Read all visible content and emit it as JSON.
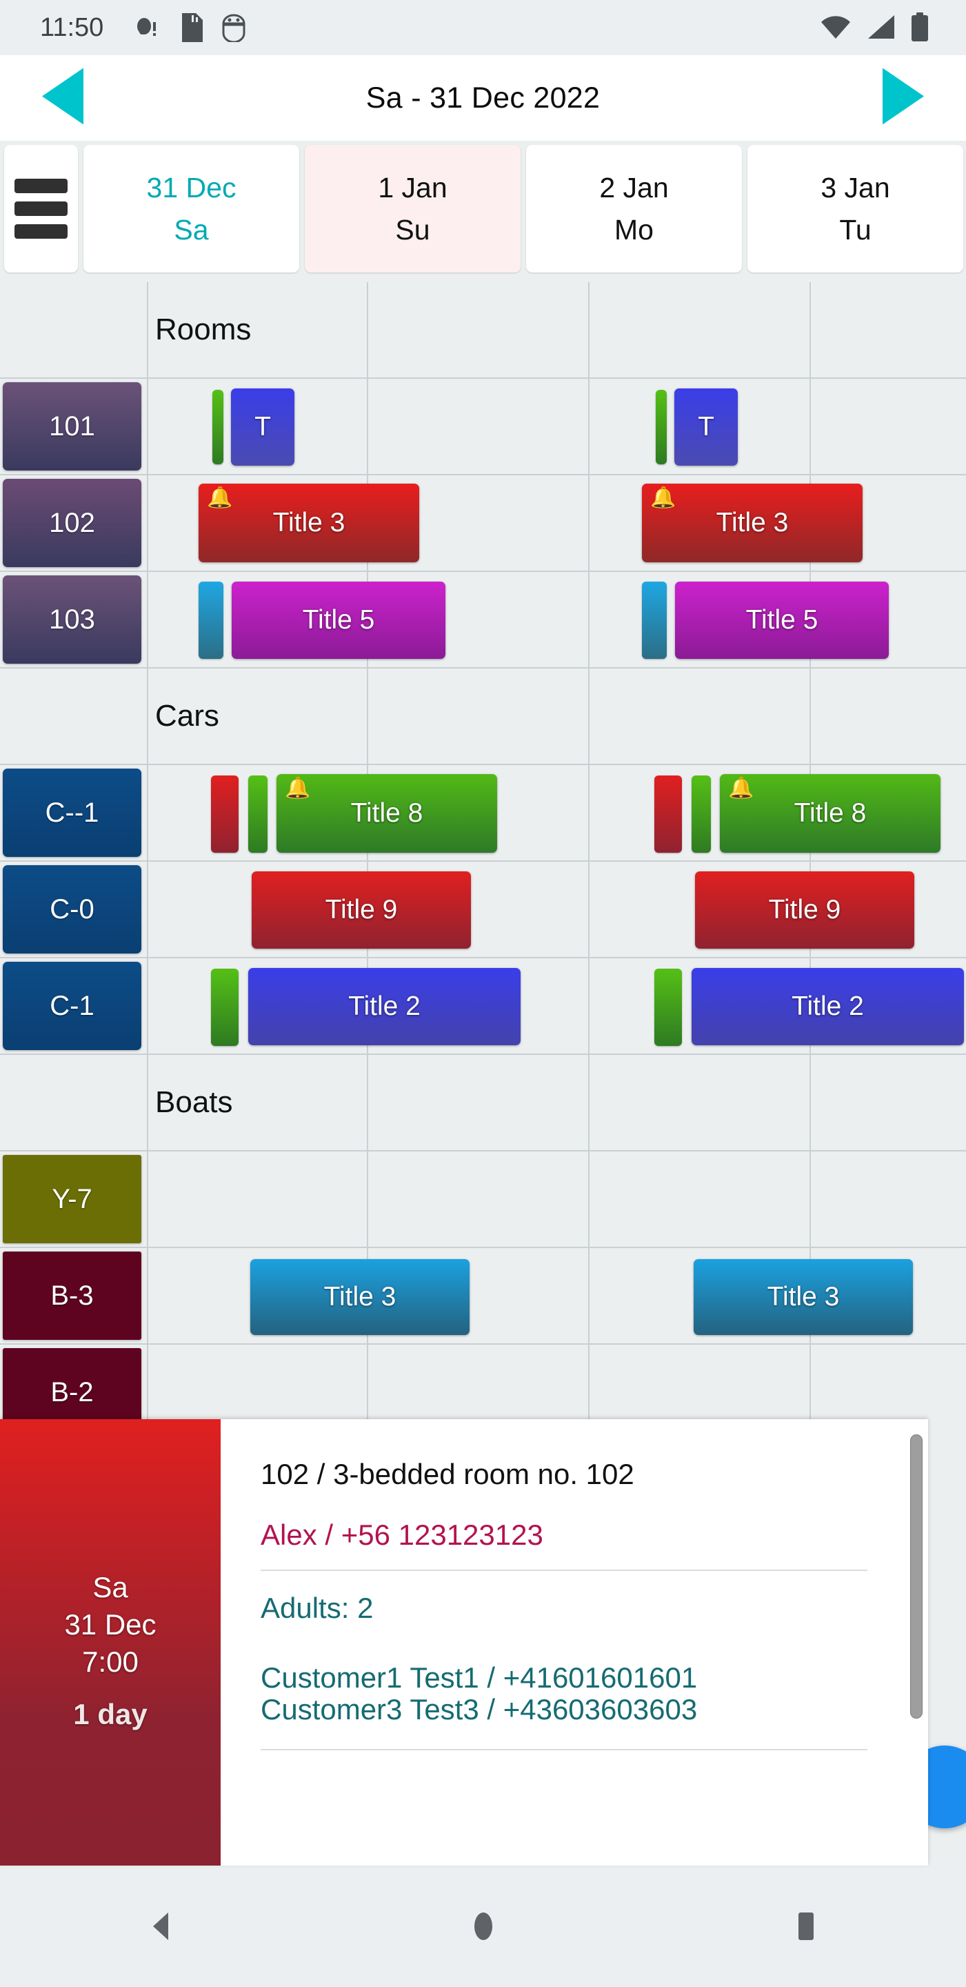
{
  "statusbar": {
    "time": "11:50",
    "left_icons": [
      "notification-dot-icon",
      "sd-card-icon",
      "android-bug-icon"
    ],
    "right_icons": [
      "wifi-icon",
      "cellular-signal-icon",
      "battery-icon"
    ]
  },
  "appbar": {
    "title": "Sa - 31 Dec 2022",
    "prev_label": "previous-day",
    "next_label": "next-day",
    "accent": "#00c4cc"
  },
  "dayheader": {
    "menu_label": "menu",
    "days": [
      {
        "date": "31 Dec",
        "weekday": "Sa",
        "today": true,
        "weekend": false
      },
      {
        "date": "1 Jan",
        "weekday": "Su",
        "today": false,
        "weekend": true
      },
      {
        "date": "2 Jan",
        "weekday": "Mo",
        "today": false,
        "weekend": false
      },
      {
        "date": "3 Jan",
        "weekday": "Tu",
        "today": false,
        "weekend": false
      }
    ]
  },
  "schedule": {
    "groups": [
      {
        "title": "Rooms",
        "rows": [
          {
            "label": "101",
            "chip_color": "linear-gradient(180deg,#6b5278 0%,#3a3a5e 100%)"
          },
          {
            "label": "102",
            "chip_color": "linear-gradient(180deg,#6b4b74 0%,#3a3a5e 100%)"
          },
          {
            "label": "103",
            "chip_color": "linear-gradient(180deg,#6b5278 0%,#3a3a5e 100%)"
          }
        ]
      },
      {
        "title": "Cars",
        "rows": [
          {
            "label": "C--1",
            "chip_color": "linear-gradient(180deg,#0d4c87 0%,#0a3f72 100%)"
          },
          {
            "label": "C-0",
            "chip_color": "linear-gradient(180deg,#0d4c87 0%,#0a3f72 100%)"
          },
          {
            "label": "C-1",
            "chip_color": "linear-gradient(180deg,#0d4c87 0%,#0a3f72 100%)"
          }
        ]
      },
      {
        "title": "Boats",
        "rows": [
          {
            "label": "Y-7",
            "chip_color": "#6b6e05"
          },
          {
            "label": "B-3",
            "chip_color": "#5e0420"
          },
          {
            "label": "B-2",
            "chip_color": "#5e0420"
          }
        ]
      }
    ],
    "events": [
      {
        "row": "101",
        "title": "T",
        "bell": false,
        "color": "linear-gradient(180deg,#3a3ee8 0%,#4b4bb0 100%)"
      },
      {
        "row": "102",
        "title": "Title 3",
        "bell": true,
        "color": "linear-gradient(180deg,#e81e1e 0%,#8f2828 100%)"
      },
      {
        "row": "103",
        "title": "Title 5",
        "bell": false,
        "color": "linear-gradient(180deg,#cc22cc 0%,#8b1b96 100%)"
      },
      {
        "row": "C--1",
        "title": "Title 8",
        "bell": true,
        "color": "linear-gradient(180deg,#52b916 0%,#2e7a28 100%)"
      },
      {
        "row": "C-0",
        "title": "Title 9",
        "bell": false,
        "color": "linear-gradient(180deg,#e02020 0%,#8f2230 100%)"
      },
      {
        "row": "C-1",
        "title": "Title 2",
        "bell": false,
        "color": "linear-gradient(180deg,#3a3ee8 0%,#4442ac 100%)"
      },
      {
        "row": "B-3",
        "title": "Title 3",
        "bell": false,
        "color": "linear-gradient(180deg,#1ba1e0 0%,#24627f 100%)"
      }
    ],
    "event_titles": {
      "e101_a": "T",
      "e101_b": "T",
      "e102_a": "Title 3",
      "e102_b": "Title 3",
      "e103_a": "Title 5",
      "e103_b": "Title 5",
      "ec1_a": "Title 8",
      "ec1_b": "Title 8",
      "ec0_a": "Title 9",
      "ec0_b": "Title 9",
      "ecm_a": "Title 2",
      "ecm_b": "Title 2",
      "eb3_a": "Title 3",
      "eb3_b": "Title 3"
    },
    "group_titles": {
      "rooms": "Rooms",
      "cars": "Cars",
      "boats": "Boats"
    },
    "row_labels": {
      "r101": "101",
      "r102": "102",
      "r103": "103",
      "rcm1": "C--1",
      "rc0": "C-0",
      "rc1": "C-1",
      "ry7": "Y-7",
      "rb3": "B-3",
      "rb2": "B-2"
    },
    "bell_glyph": "🔔"
  },
  "detail": {
    "weekday": "Sa",
    "date": "31 Dec",
    "time": "7:00",
    "duration": "1 day",
    "resource_line": "102  /  3-bedded room no. 102",
    "contact_line": "Alex / +56 123123123",
    "adults_line": "Adults: 2",
    "customers": [
      "Customer1 Test1 / +41601601601",
      "Customer3 Test3 / +43603603603"
    ]
  },
  "bottomnav": {
    "back_label": "back",
    "home_label": "home",
    "recents_label": "recent-apps"
  }
}
